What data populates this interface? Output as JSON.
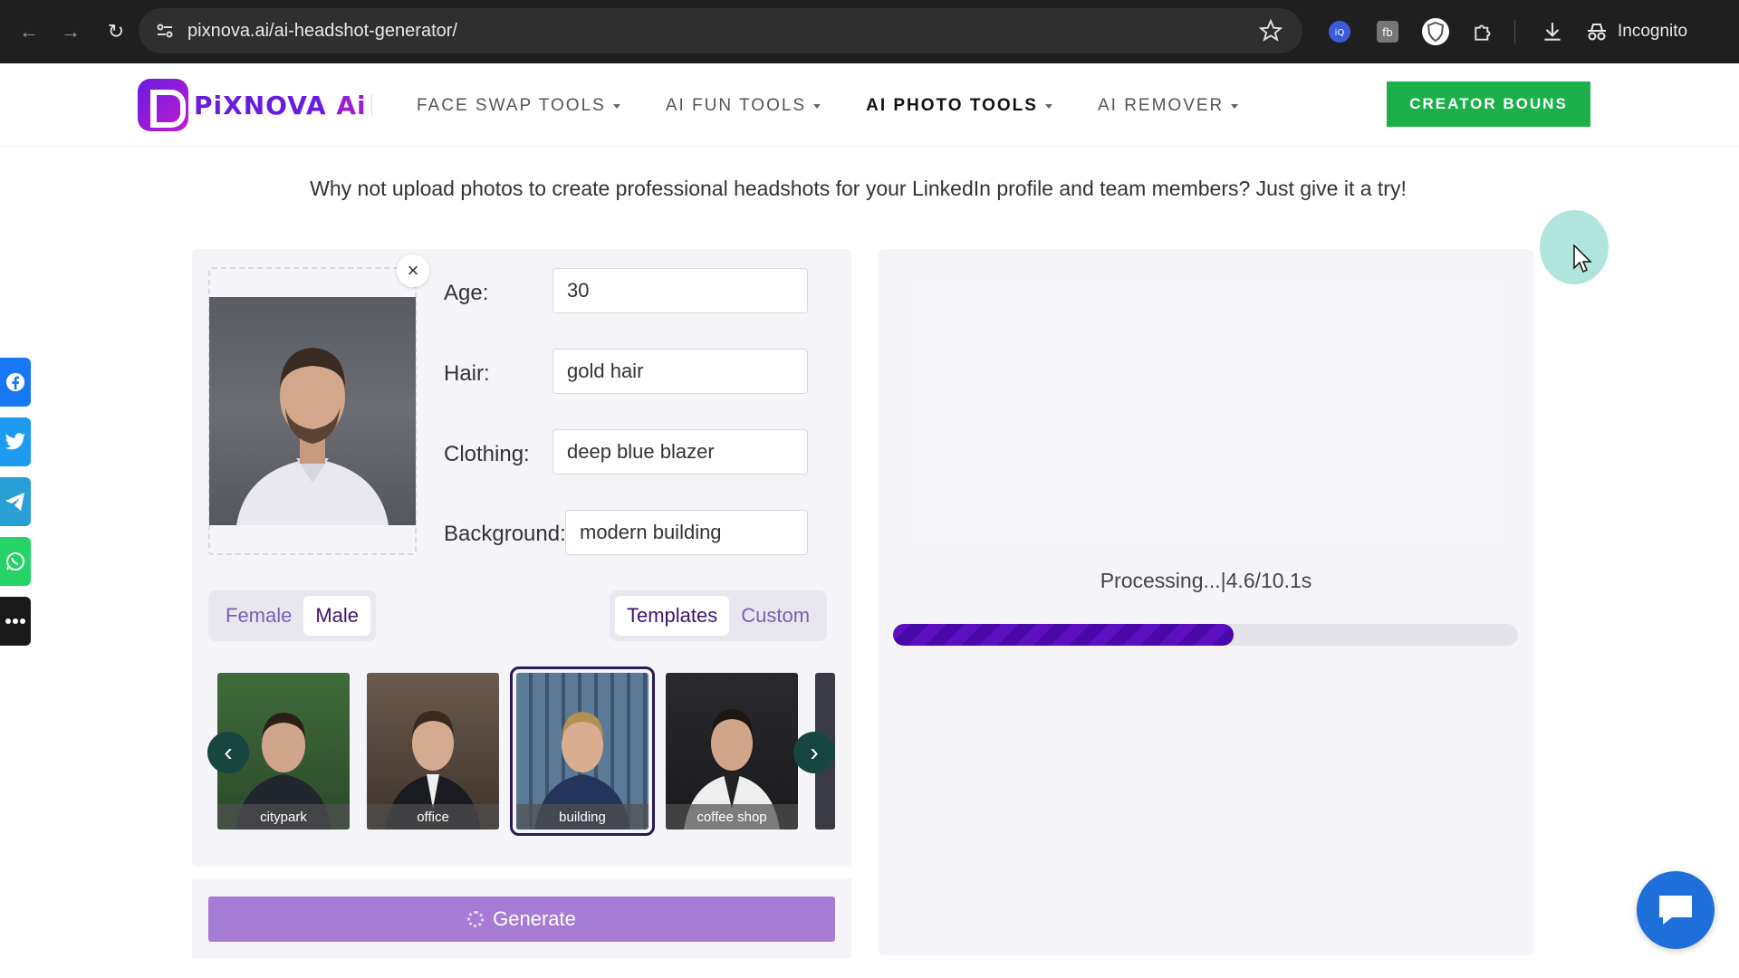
{
  "browser": {
    "url": "pixnova.ai/ai-headshot-generator/",
    "incognito_label": "Incognito"
  },
  "header": {
    "logo_text": "PiXNOVA",
    "logo_ai": "Ai",
    "menu": [
      {
        "label": "FACE SWAP TOOLS"
      },
      {
        "label": "AI FUN TOOLS"
      },
      {
        "label": "AI PHOTO TOOLS"
      },
      {
        "label": "AI REMOVER"
      }
    ],
    "cta_label": "CREATOR BOUNS"
  },
  "page": {
    "subtitle": "Why not upload photos to create professional headshots for your LinkedIn profile and team members? Just give it a try!"
  },
  "form": {
    "age_label": "Age:",
    "age_value": "30",
    "hair_label": "Hair:",
    "hair_value": "gold hair",
    "clothing_label": "Clothing:",
    "clothing_value": "deep blue blazer",
    "background_label": "Background:",
    "background_value": "modern building"
  },
  "gender_toggle": {
    "options": [
      "Female",
      "Male"
    ],
    "selected": "Male"
  },
  "mode_toggle": {
    "options": [
      "Templates",
      "Custom"
    ],
    "selected": "Templates"
  },
  "templates": [
    {
      "label": "citypark"
    },
    {
      "label": "office"
    },
    {
      "label": "building"
    },
    {
      "label": "coffee shop"
    }
  ],
  "selected_template": "building",
  "generate_label": "Generate",
  "processing": {
    "text": "Processing...|4.6/10.1s",
    "progress": 0.545
  },
  "colors": {
    "brand_purple": "#6a1be0",
    "cta_green": "#1bb04a",
    "progress": "#5b0fbf",
    "generate": "#a67bd3"
  }
}
